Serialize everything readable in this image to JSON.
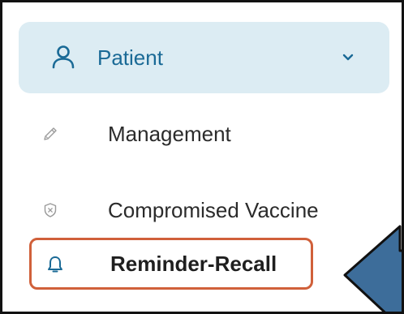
{
  "menu": {
    "header": {
      "label": "Patient",
      "icon": "user-icon",
      "expand_icon": "chevron-down-icon",
      "background": "#dcecf3",
      "accent": "#1a6a96"
    },
    "items": [
      {
        "label": "Management",
        "icon": "pencil-icon"
      },
      {
        "label": "Compromised Vaccine",
        "icon": "shield-icon"
      },
      {
        "label": "Reminder-Recall",
        "icon": "bell-icon",
        "highlighted": true
      }
    ]
  },
  "annotations": {
    "highlight_color": "#d0603a",
    "arrow_color": "#3d6d9a"
  }
}
